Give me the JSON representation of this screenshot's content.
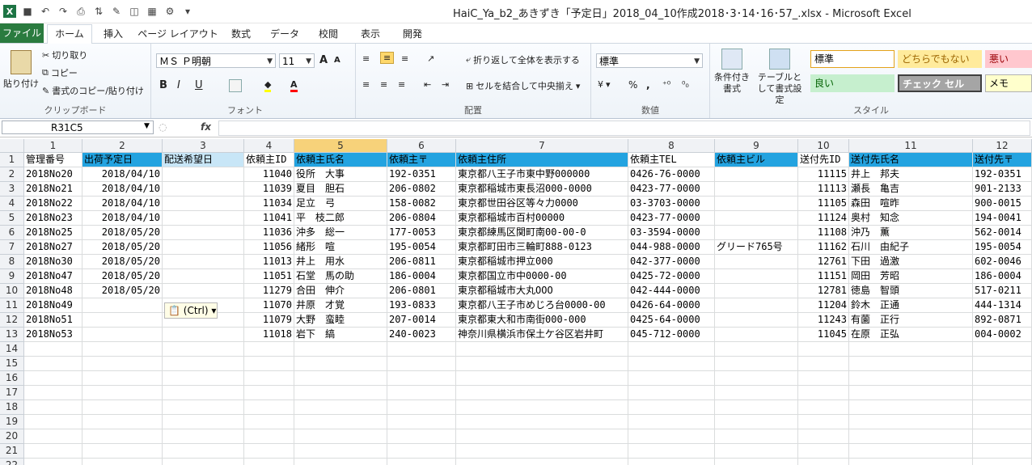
{
  "window": {
    "title": "HaiC_Ya_b2_あきずき「予定日」2018_04_10作成2018･3･14･16･57_.xlsx - Microsoft Excel"
  },
  "tabs": [
    "ファイル",
    "ホーム",
    "挿入",
    "ページ レイアウト",
    "数式",
    "データ",
    "校閲",
    "表示",
    "開発"
  ],
  "ribbon": {
    "clipboard": {
      "label": "クリップボード",
      "paste": "貼り付け",
      "cut": "切り取り",
      "copy": "コピー",
      "format_painter": "書式のコピー/貼り付け"
    },
    "font": {
      "label": "フォント",
      "name": "ＭＳ Ｐ明朝",
      "size": "11",
      "bold": "B",
      "italic": "I",
      "underline": "U",
      "grow": "A",
      "shrink": "A"
    },
    "alignment": {
      "label": "配置",
      "wrap": "折り返して全体を表示する",
      "merge": "セルを結合して中央揃え"
    },
    "number": {
      "label": "数値",
      "format": "標準",
      "percent": "%",
      "comma": ","
    },
    "styles": {
      "label": "スタイル",
      "cond": "条件付き書式",
      "table": "テーブルとして書式設定",
      "cells": [
        {
          "text": "標準",
          "bg": "#ffffff",
          "border": "#e3a21a",
          "color": "#000000"
        },
        {
          "text": "どちらでもない",
          "bg": "#ffeb9c",
          "border": "#ffeb9c",
          "color": "#9c6500"
        },
        {
          "text": "悪い",
          "bg": "#ffc7ce",
          "border": "#ffc7ce",
          "color": "#9c0006"
        },
        {
          "text": "良い",
          "bg": "#c6efce",
          "border": "#c6efce",
          "color": "#006100"
        },
        {
          "text": "チェック セル",
          "bg": "#a5a5a5",
          "border": "#3f3f3f",
          "color": "#ffffff"
        },
        {
          "text": "メモ",
          "bg": "#ffffcc",
          "border": "#b2b2b2",
          "color": "#000000"
        }
      ]
    }
  },
  "formula_bar": {
    "name_box": "R31C5",
    "fx": "fx",
    "value": ""
  },
  "columns": [
    "1",
    "2",
    "3",
    "4",
    "5",
    "6",
    "7",
    "8",
    "9",
    "10",
    "11",
    "12"
  ],
  "selected_column": "5",
  "rows": [
    [
      "管理番号",
      "出荷予定日",
      "配送希望日",
      "依頼主ID",
      "依頼主氏名",
      "依頼主〒",
      "依頼主住所",
      "依頼主TEL",
      "依頼主ビル",
      "送付先ID",
      "送付先氏名",
      "送付先〒"
    ],
    [
      "2018No20",
      "2018/04/10",
      "",
      "11040",
      "役所　大事",
      "192-0351",
      "東京都八王子市東中野000000",
      "0426-76-0000",
      "",
      "11115",
      "井上　邦夫",
      "192-0351"
    ],
    [
      "2018No21",
      "2018/04/10",
      "",
      "11039",
      "夏目　胆石",
      "206-0802",
      "東京都稲城市東長沼000-0000",
      "0423-77-0000",
      "",
      "11113",
      "瀬長　亀吉",
      "901-2133"
    ],
    [
      "2018No22",
      "2018/04/10",
      "",
      "11034",
      "足立　弓",
      "158-0082",
      "東京都世田谷区等々力0000",
      "03-3703-0000",
      "",
      "11105",
      "森田　喧昨",
      "900-0015"
    ],
    [
      "2018No23",
      "2018/04/10",
      "",
      "11041",
      "平　枝二郎",
      "206-0804",
      "東京都稲城市百村00000",
      "0423-77-0000",
      "",
      "11124",
      "奥村　知念",
      "194-0041"
    ],
    [
      "2018No25",
      "2018/05/20",
      "",
      "11036",
      "沖多　総一",
      "177-0053",
      "東京都練馬区関町南00-00-0",
      "03-3594-0000",
      "",
      "11108",
      "沖乃　薫",
      "562-0014"
    ],
    [
      "2018No27",
      "2018/05/20",
      "",
      "11056",
      "緒形　喧",
      "195-0054",
      "東京都町田市三輪町888-0123",
      "044-988-0000",
      "グリード765号",
      "11162",
      "石川　由紀子",
      "195-0054"
    ],
    [
      "2018No30",
      "2018/05/20",
      "",
      "11013",
      "井上　用水",
      "206-0811",
      "東京都稲城市押立000",
      "042-377-0000",
      "",
      "12761",
      "下田　過激",
      "602-0046"
    ],
    [
      "2018No47",
      "2018/05/20",
      "",
      "11051",
      "石堂　馬の助",
      "186-0004",
      "東京都国立市中0000-00",
      "0425-72-0000",
      "",
      "11151",
      "岡田　芳昭",
      "186-0004"
    ],
    [
      "2018No48",
      "2018/05/20",
      "",
      "11279",
      "合田　伸介",
      "206-0801",
      "東京都稲城市大丸OOO",
      "042-444-0000",
      "",
      "12781",
      "徳島　智頭",
      "517-0211"
    ],
    [
      "2018No49",
      "",
      "",
      "11070",
      "井原　才覚",
      "193-0833",
      "東京都八王子市めじろ台0000-00",
      "0426-64-0000",
      "",
      "11204",
      "鈴木　正通",
      "444-1314"
    ],
    [
      "2018No51",
      "",
      "",
      "11079",
      "大野　蛮睦",
      "207-0014",
      "東京都東大和市南街000-000",
      "0425-64-0000",
      "",
      "11243",
      "有薗　正行",
      "892-0871"
    ],
    [
      "2018No53",
      "",
      "",
      "11018",
      "岩下　縞",
      "240-0023",
      "神奈川県横浜市保土ケ谷区岩井町",
      "045-712-0000",
      "",
      "11045",
      "在原　正弘",
      "004-0002"
    ]
  ],
  "row_numbers": [
    "1",
    "2",
    "3",
    "4",
    "5",
    "6",
    "7",
    "8",
    "9",
    "10",
    "11",
    "12",
    "13",
    "14",
    "15",
    "16",
    "17",
    "18",
    "19",
    "20",
    "21",
    "22"
  ],
  "paste_tag": "(Ctrl)",
  "colors": {
    "header_blue": "#23a3e0",
    "header_light": "#c8e6f7",
    "selected_col": "#f7d27a",
    "file_tab": "#2a7b3f"
  }
}
